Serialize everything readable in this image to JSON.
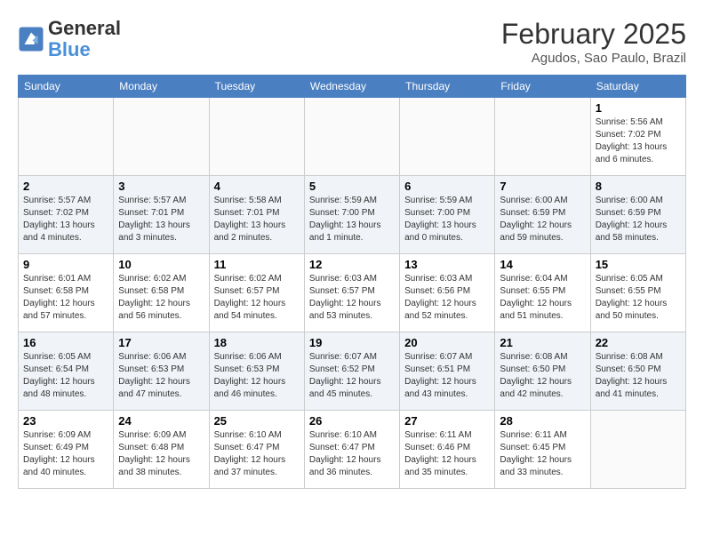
{
  "header": {
    "logo_line1": "General",
    "logo_line2": "Blue",
    "month_title": "February 2025",
    "location": "Agudos, Sao Paulo, Brazil"
  },
  "weekdays": [
    "Sunday",
    "Monday",
    "Tuesday",
    "Wednesday",
    "Thursday",
    "Friday",
    "Saturday"
  ],
  "weeks": [
    [
      {
        "day": "",
        "info": ""
      },
      {
        "day": "",
        "info": ""
      },
      {
        "day": "",
        "info": ""
      },
      {
        "day": "",
        "info": ""
      },
      {
        "day": "",
        "info": ""
      },
      {
        "day": "",
        "info": ""
      },
      {
        "day": "1",
        "info": "Sunrise: 5:56 AM\nSunset: 7:02 PM\nDaylight: 13 hours and 6 minutes."
      }
    ],
    [
      {
        "day": "2",
        "info": "Sunrise: 5:57 AM\nSunset: 7:02 PM\nDaylight: 13 hours and 4 minutes."
      },
      {
        "day": "3",
        "info": "Sunrise: 5:57 AM\nSunset: 7:01 PM\nDaylight: 13 hours and 3 minutes."
      },
      {
        "day": "4",
        "info": "Sunrise: 5:58 AM\nSunset: 7:01 PM\nDaylight: 13 hours and 2 minutes."
      },
      {
        "day": "5",
        "info": "Sunrise: 5:59 AM\nSunset: 7:00 PM\nDaylight: 13 hours and 1 minute."
      },
      {
        "day": "6",
        "info": "Sunrise: 5:59 AM\nSunset: 7:00 PM\nDaylight: 13 hours and 0 minutes."
      },
      {
        "day": "7",
        "info": "Sunrise: 6:00 AM\nSunset: 6:59 PM\nDaylight: 12 hours and 59 minutes."
      },
      {
        "day": "8",
        "info": "Sunrise: 6:00 AM\nSunset: 6:59 PM\nDaylight: 12 hours and 58 minutes."
      }
    ],
    [
      {
        "day": "9",
        "info": "Sunrise: 6:01 AM\nSunset: 6:58 PM\nDaylight: 12 hours and 57 minutes."
      },
      {
        "day": "10",
        "info": "Sunrise: 6:02 AM\nSunset: 6:58 PM\nDaylight: 12 hours and 56 minutes."
      },
      {
        "day": "11",
        "info": "Sunrise: 6:02 AM\nSunset: 6:57 PM\nDaylight: 12 hours and 54 minutes."
      },
      {
        "day": "12",
        "info": "Sunrise: 6:03 AM\nSunset: 6:57 PM\nDaylight: 12 hours and 53 minutes."
      },
      {
        "day": "13",
        "info": "Sunrise: 6:03 AM\nSunset: 6:56 PM\nDaylight: 12 hours and 52 minutes."
      },
      {
        "day": "14",
        "info": "Sunrise: 6:04 AM\nSunset: 6:55 PM\nDaylight: 12 hours and 51 minutes."
      },
      {
        "day": "15",
        "info": "Sunrise: 6:05 AM\nSunset: 6:55 PM\nDaylight: 12 hours and 50 minutes."
      }
    ],
    [
      {
        "day": "16",
        "info": "Sunrise: 6:05 AM\nSunset: 6:54 PM\nDaylight: 12 hours and 48 minutes."
      },
      {
        "day": "17",
        "info": "Sunrise: 6:06 AM\nSunset: 6:53 PM\nDaylight: 12 hours and 47 minutes."
      },
      {
        "day": "18",
        "info": "Sunrise: 6:06 AM\nSunset: 6:53 PM\nDaylight: 12 hours and 46 minutes."
      },
      {
        "day": "19",
        "info": "Sunrise: 6:07 AM\nSunset: 6:52 PM\nDaylight: 12 hours and 45 minutes."
      },
      {
        "day": "20",
        "info": "Sunrise: 6:07 AM\nSunset: 6:51 PM\nDaylight: 12 hours and 43 minutes."
      },
      {
        "day": "21",
        "info": "Sunrise: 6:08 AM\nSunset: 6:50 PM\nDaylight: 12 hours and 42 minutes."
      },
      {
        "day": "22",
        "info": "Sunrise: 6:08 AM\nSunset: 6:50 PM\nDaylight: 12 hours and 41 minutes."
      }
    ],
    [
      {
        "day": "23",
        "info": "Sunrise: 6:09 AM\nSunset: 6:49 PM\nDaylight: 12 hours and 40 minutes."
      },
      {
        "day": "24",
        "info": "Sunrise: 6:09 AM\nSunset: 6:48 PM\nDaylight: 12 hours and 38 minutes."
      },
      {
        "day": "25",
        "info": "Sunrise: 6:10 AM\nSunset: 6:47 PM\nDaylight: 12 hours and 37 minutes."
      },
      {
        "day": "26",
        "info": "Sunrise: 6:10 AM\nSunset: 6:47 PM\nDaylight: 12 hours and 36 minutes."
      },
      {
        "day": "27",
        "info": "Sunrise: 6:11 AM\nSunset: 6:46 PM\nDaylight: 12 hours and 35 minutes."
      },
      {
        "day": "28",
        "info": "Sunrise: 6:11 AM\nSunset: 6:45 PM\nDaylight: 12 hours and 33 minutes."
      },
      {
        "day": "",
        "info": ""
      }
    ]
  ]
}
